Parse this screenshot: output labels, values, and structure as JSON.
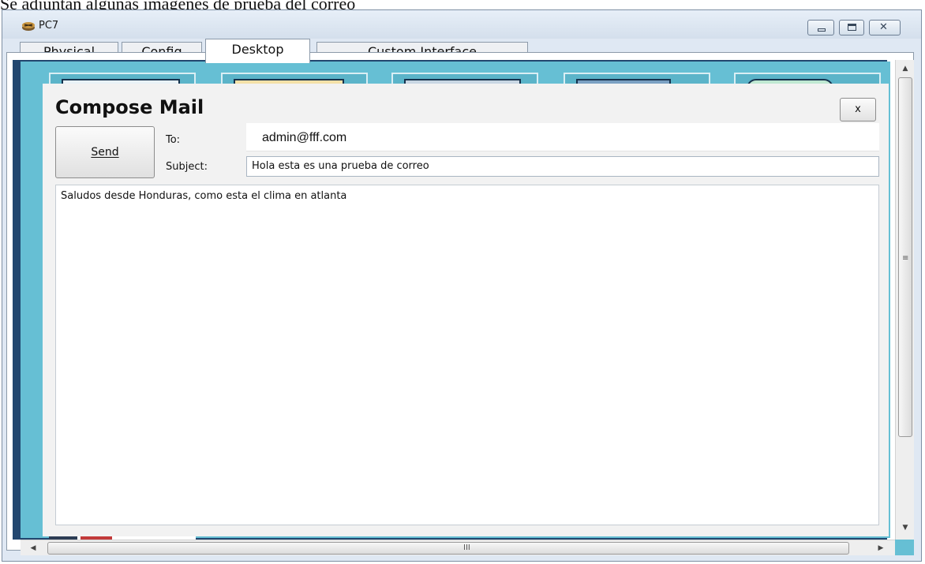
{
  "document": {
    "caption": "Se adjuntan algunas imagenes de prueba del correo"
  },
  "window": {
    "title": "PC7",
    "icon": "router-device-icon",
    "controls": {
      "close_glyph": "✕"
    }
  },
  "tabs": [
    {
      "label": "Physical",
      "active": false
    },
    {
      "label": "Config",
      "active": false
    },
    {
      "label": "Desktop",
      "active": true
    },
    {
      "label": "Custom Interface",
      "active": false
    }
  ],
  "compose": {
    "title": "Compose Mail",
    "close_label": "x",
    "send_label": "Send",
    "to_label": "To:",
    "to_value": "admin@fff.com",
    "subject_label": "Subject:",
    "subject_value": "Hola esta es una prueba de correo",
    "body_value": "Saludos desde Honduras, como esta el clima en atlanta"
  },
  "scrollbars": {
    "up_glyph": "▲",
    "down_glyph": "▼",
    "left_glyph": "◀",
    "right_glyph": "▶",
    "v_grip": "≡",
    "h_grip": "III"
  },
  "colors": {
    "desktop_background": "#66bfd4",
    "window_chrome": "#dfe8f3"
  }
}
